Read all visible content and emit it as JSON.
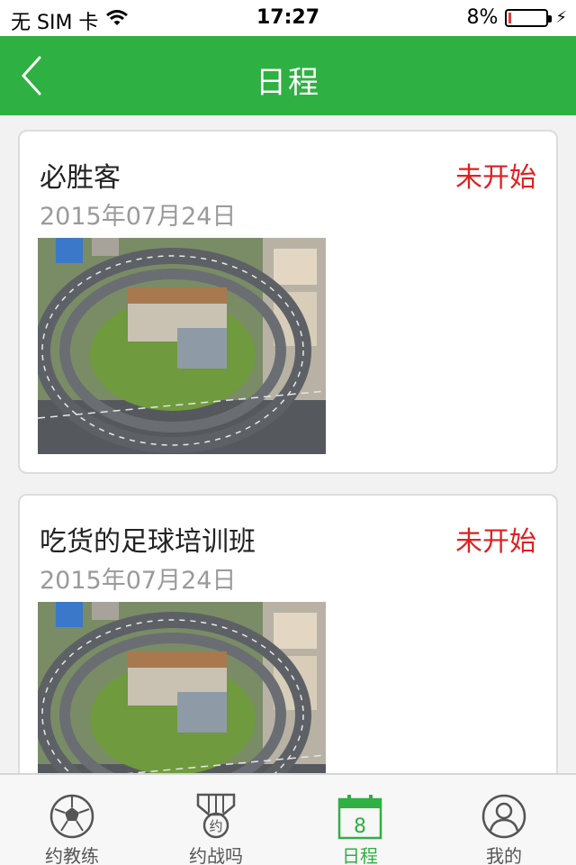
{
  "status_bar": {
    "carrier": "无 SIM 卡",
    "time": "17:27",
    "battery": "8%",
    "battery_level": 0.08
  },
  "header": {
    "title": "日程",
    "back_icon": "chevron-left-icon"
  },
  "events": [
    {
      "name": "必胜客",
      "status": "未开始",
      "date": "2015年07月24日",
      "image": "aerial-interchange-photo"
    },
    {
      "name": "吃货的足球培训班",
      "status": "未开始",
      "date": "2015年07月24日",
      "image": "aerial-interchange-photo"
    }
  ],
  "tabbar": {
    "tabs": [
      {
        "label": "约教练",
        "icon": "soccer-ball-icon",
        "active": false
      },
      {
        "label": "约战吗",
        "icon": "medal-icon",
        "icon_text": "约",
        "active": false
      },
      {
        "label": "日程",
        "icon": "calendar-icon",
        "icon_text": "8",
        "active": true
      },
      {
        "label": "我的",
        "icon": "user-icon",
        "active": false
      }
    ]
  },
  "colors": {
    "brand_green": "#2fb042",
    "status_red": "#e02020",
    "date_gray": "#9a9a9a"
  }
}
